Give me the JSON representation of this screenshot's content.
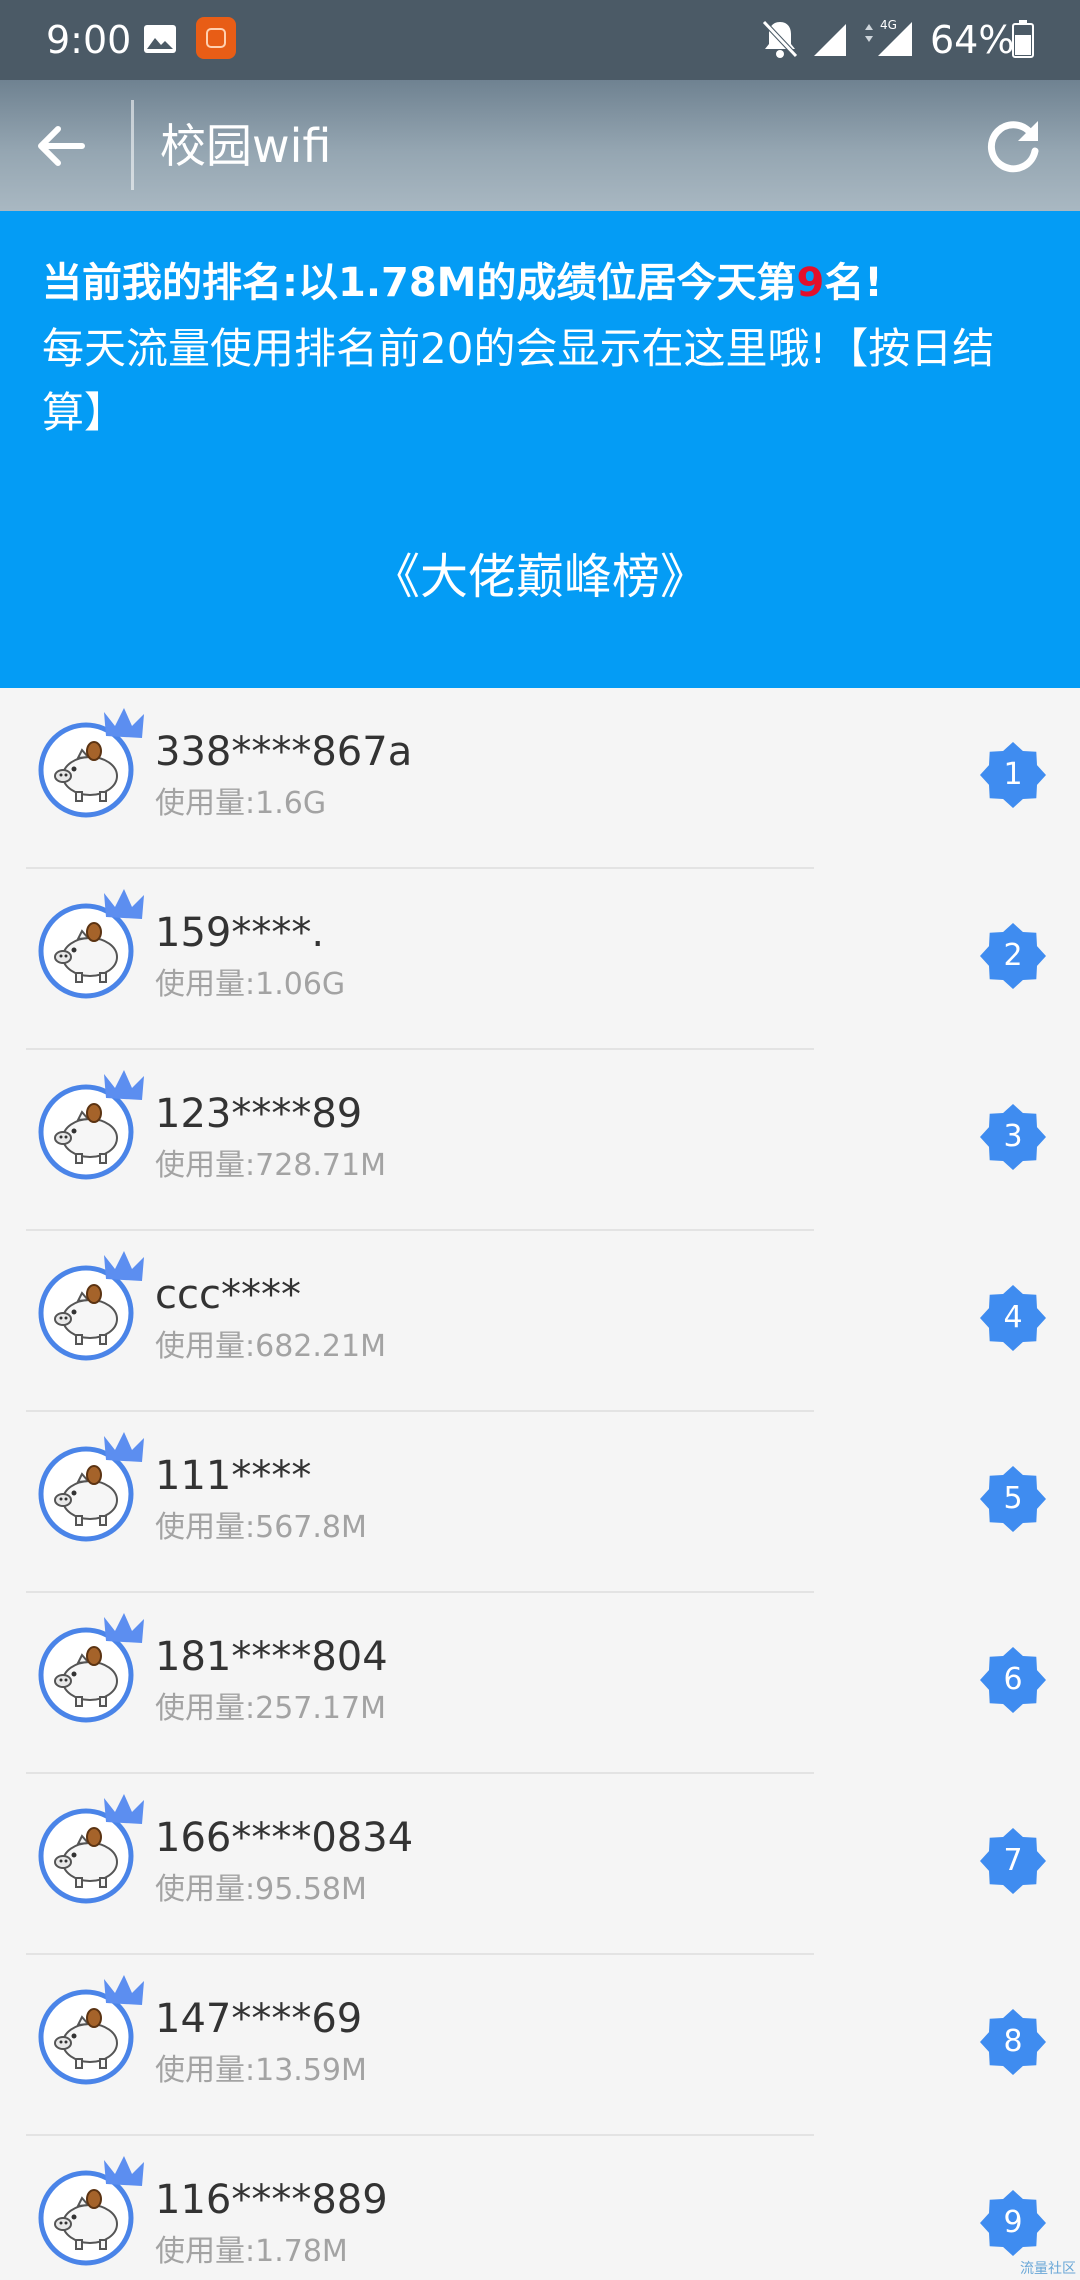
{
  "status_bar": {
    "time": "9:00",
    "network": "4G",
    "battery": "64%",
    "icons": [
      "gallery-icon",
      "app-notification-icon",
      "bell-off-icon",
      "signal-icon",
      "signal-4g-icon",
      "battery-icon"
    ]
  },
  "app_bar": {
    "title": "校园wifi",
    "back_icon": "arrow-left-icon",
    "refresh_icon": "refresh-icon"
  },
  "banner": {
    "rank_prefix": "当前我的排名:以1.78M的成绩位居今天第",
    "rank_value": "9",
    "rank_suffix": "名!",
    "description": "每天流量使用排名前20的会显示在这里哦!【按日结算】",
    "board_title": "《大佬巅峰榜》",
    "color": "#049cf5",
    "rank_value_color": "#e3102b"
  },
  "list": {
    "avatar_icon": "crowned-piggy-bank-avatar",
    "badge_color": "#3f8cf0",
    "items": [
      {
        "name": "338****867a",
        "usage": "使用量:1.6G",
        "rank": "1"
      },
      {
        "name": "159****.",
        "usage": "使用量:1.06G",
        "rank": "2"
      },
      {
        "name": "123****89",
        "usage": "使用量:728.71M",
        "rank": "3"
      },
      {
        "name": "ccc****",
        "usage": "使用量:682.21M",
        "rank": "4"
      },
      {
        "name": "111****",
        "usage": "使用量:567.8M",
        "rank": "5"
      },
      {
        "name": "181****804",
        "usage": "使用量:257.17M",
        "rank": "6"
      },
      {
        "name": "166****0834",
        "usage": "使用量:95.58M",
        "rank": "7"
      },
      {
        "name": "147****69",
        "usage": "使用量:13.59M",
        "rank": "8"
      },
      {
        "name": "116****889",
        "usage": "使用量:1.78M",
        "rank": "9"
      }
    ]
  },
  "watermark": "流量社区"
}
